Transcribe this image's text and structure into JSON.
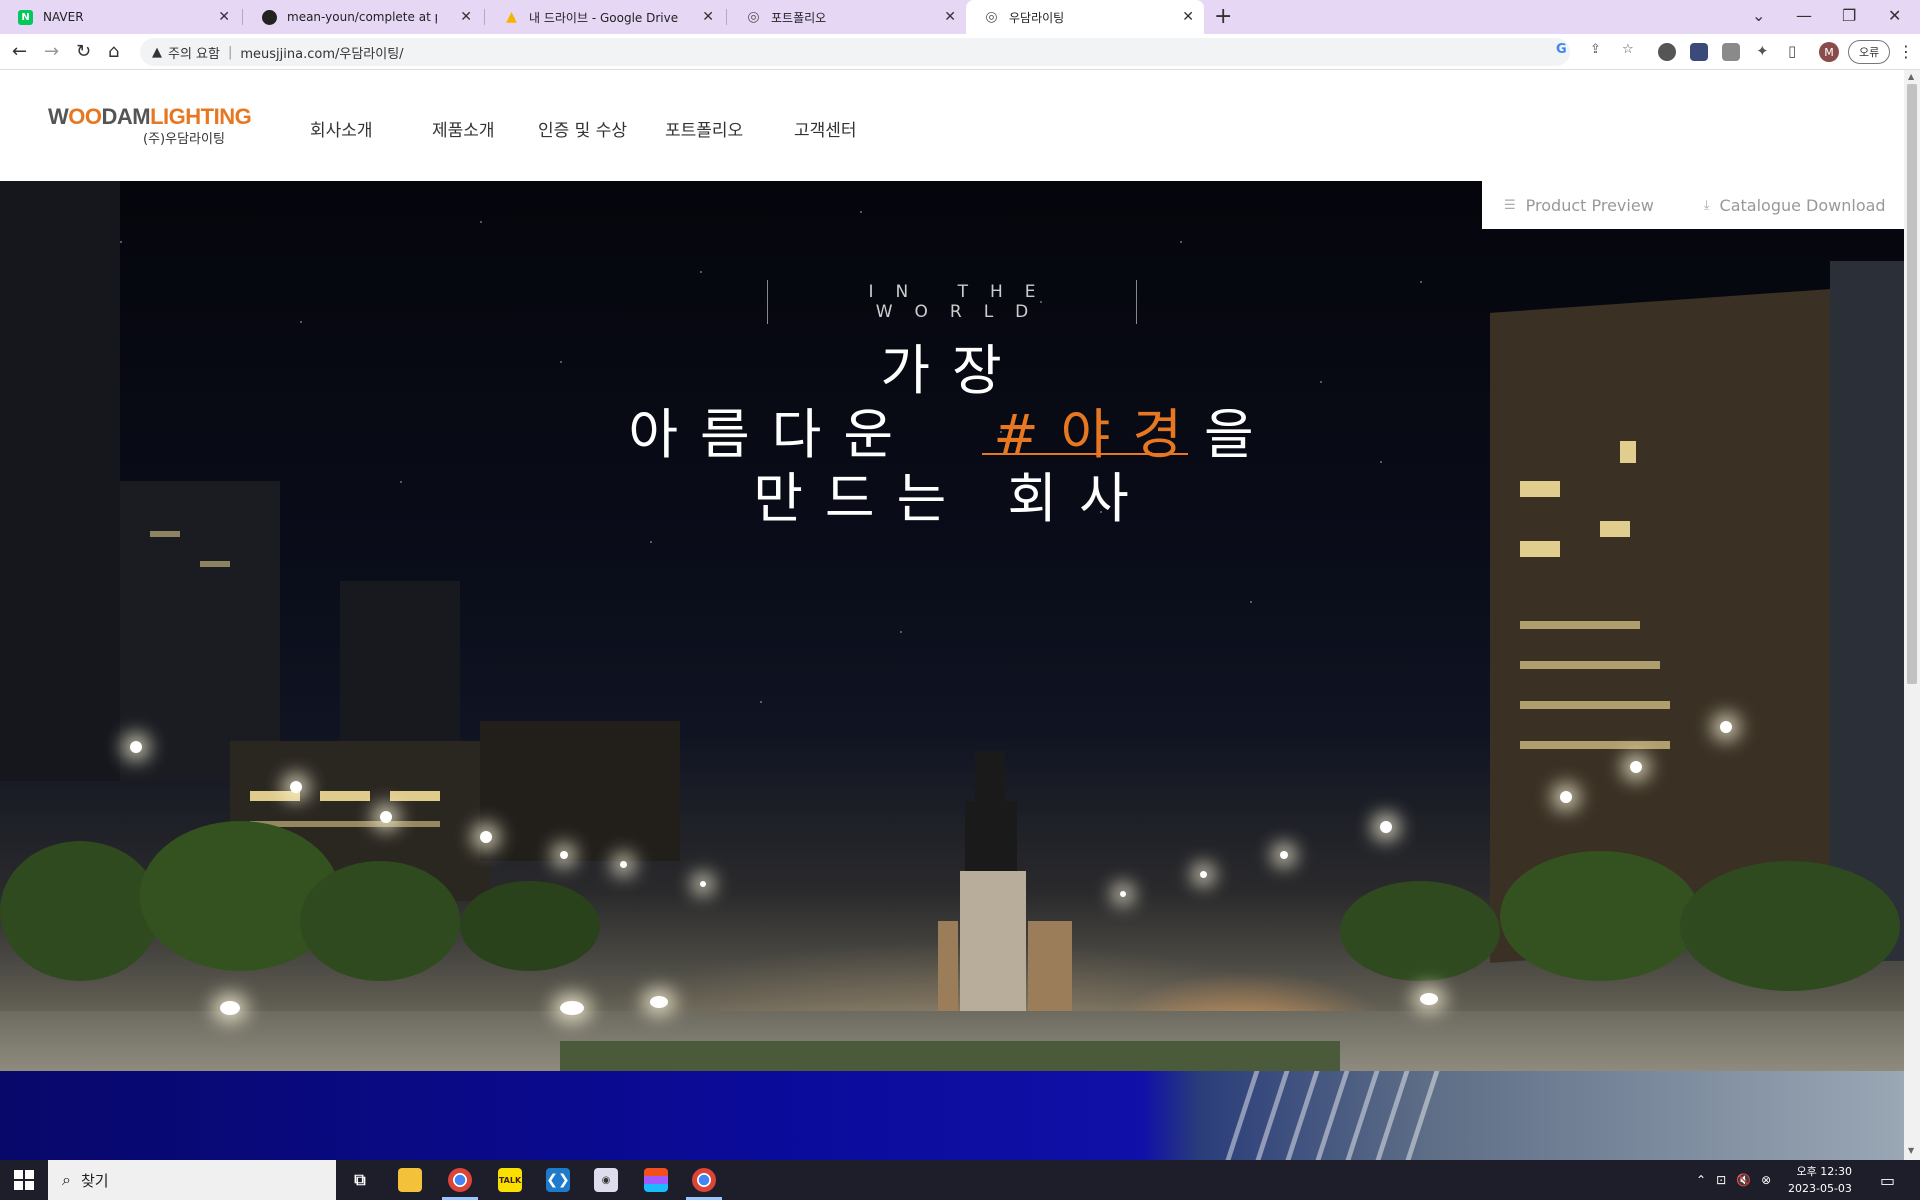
{
  "browser": {
    "tabs": [
      {
        "title": "NAVER",
        "favicon": "naver-icon",
        "color": "#03c75a",
        "glyph": "N"
      },
      {
        "title": "mean-youn/complete at project",
        "favicon": "github-icon",
        "color": "#222222",
        "glyph": "●"
      },
      {
        "title": "내 드라이브 - Google Drive",
        "favicon": "google-drive-icon",
        "color": "#f4b400",
        "glyph": "▲"
      },
      {
        "title": "포트폴리오",
        "favicon": "globe-icon",
        "color": "#555555",
        "glyph": "◎"
      },
      {
        "title": "우담라이팅",
        "favicon": "globe-icon",
        "color": "#555555",
        "glyph": "◎"
      }
    ],
    "active_tab": 4,
    "security_label": "주의 요함",
    "url": "meusjjina.com/우담라이팅/",
    "error_button": "오류"
  },
  "site": {
    "logo": {
      "w": "W",
      "oo": "OO",
      "dam": "DAM",
      "lighting": "LIGHTING",
      "sub": "(주)우담라이팅"
    },
    "nav": [
      "회사소개",
      "제품소개",
      "인증 및 수상",
      "포트폴리오",
      "고객센터"
    ],
    "quick_links": {
      "preview": "Product Preview",
      "catalogue": "Catalogue Download"
    },
    "hero": {
      "tagline": "IN THE WORLD",
      "line1": "가장",
      "line2_before": "아름다운",
      "line2_accent": "#야경",
      "line2_after": "을",
      "line3": "만드는 회사"
    },
    "accent_color": "#e87722"
  },
  "taskbar": {
    "search_placeholder": "찾기",
    "apps": [
      "task-view-icon",
      "file-explorer-icon",
      "chrome-icon",
      "kakaotalk-icon",
      "vscode-icon",
      "app-icon",
      "figma-icon",
      "chrome-icon"
    ],
    "kakao_label": "TALK",
    "time": "오후 12:30",
    "date": "2023-05-03"
  }
}
